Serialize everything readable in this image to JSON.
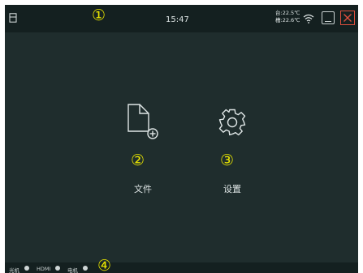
{
  "header": {
    "time": "15:47",
    "temperature_1": "台:22.5℃",
    "temperature_2": "槽:22.6℃",
    "icons": [
      "device-icon",
      "wifi-icon",
      "minimize-icon",
      "close-icon"
    ]
  },
  "main": {
    "tiles": [
      {
        "label": "文件",
        "icon": "add-file-icon"
      },
      {
        "label": "设置",
        "icon": "gear-icon"
      }
    ]
  },
  "status": {
    "items": [
      "光机",
      "HDMI",
      "电机"
    ]
  },
  "annotations": [
    "①",
    "②",
    "③",
    "④"
  ],
  "colors": {
    "background": "#1f2d2d",
    "bar": "#142020",
    "annotation": "#e8e400",
    "close": "#e0503e",
    "text": "#dfe6e6"
  }
}
